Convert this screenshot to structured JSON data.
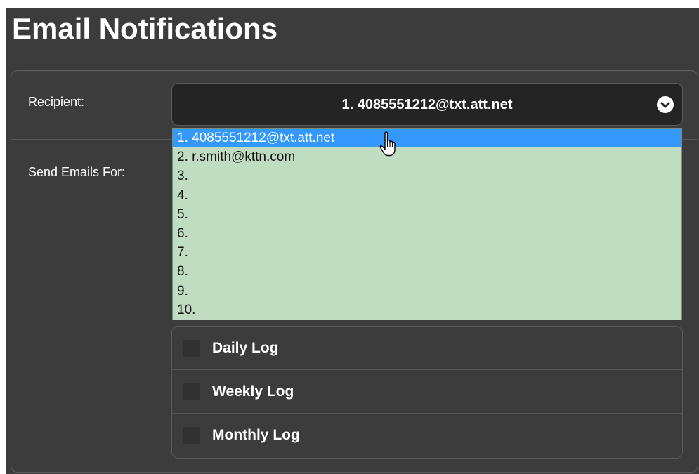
{
  "page": {
    "title": "Email Notifications"
  },
  "recipient": {
    "label": "Recipient:",
    "selected": "1. 4085551212@txt.att.net",
    "options": [
      "1. 4085551212@txt.att.net",
      "2. r.smith@kttn.com",
      "3.",
      "4.",
      "5.",
      "6.",
      "7.",
      "8.",
      "9.",
      "10."
    ],
    "highlighted_option": "1. 4085551212@txt.att.net"
  },
  "send_emails_for": {
    "label": "Send Emails For:",
    "options": [
      {
        "label": "Daily Log",
        "checked": false
      },
      {
        "label": "Weekly Log",
        "checked": false
      },
      {
        "label": "Monthly Log",
        "checked": false
      }
    ]
  },
  "icons": {
    "dropdown": "chevron-down-icon",
    "cursor": "hand-pointer-cursor"
  },
  "colors": {
    "background": "#3c3c3c",
    "select_background": "#242424",
    "dropdown_background": "#c0dcc1",
    "highlight": "#3399ff",
    "text": "#ffffff"
  }
}
